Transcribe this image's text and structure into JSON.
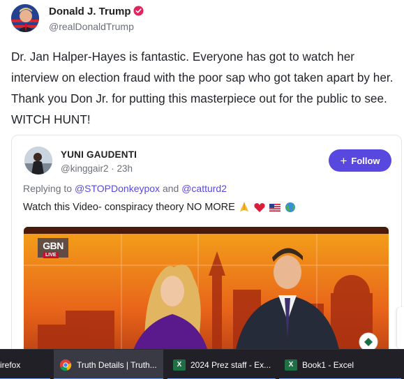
{
  "post": {
    "author_name": "Donald J. Trump",
    "author_handle": "@realDonaldTrump",
    "text": "Dr. Jan Halper-Hayes is fantastic. Everyone has got to watch her interview on election fraud with the poor sap who got taken apart by her. Thank you Don Jr. for putting this masterpiece out for the public to see. WITCH HUNT!"
  },
  "quote": {
    "author_name": "YUNI GAUDENTI",
    "author_handle": "@kinggair2",
    "time": "23h",
    "follow_label": "Follow",
    "replying_prefix": "Replying to",
    "replying_to_1": "@STOPDonkeypox",
    "replying_and": "and",
    "replying_to_2": "@catturd2",
    "text": "Watch this Video- conspiracy theory NO MORE",
    "video": {
      "logo": "GBN",
      "live_label": "LIVE"
    }
  },
  "taskbar": {
    "items": [
      {
        "label": "irefox",
        "icon": "firefox-icon"
      },
      {
        "label": "Truth Details | Truth...",
        "icon": "chrome-icon"
      },
      {
        "label": "2024 Prez staff - Ex...",
        "icon": "excel-icon"
      },
      {
        "label": "Book1 - Excel",
        "icon": "excel-icon"
      }
    ]
  },
  "colors": {
    "accent": "#5848e0",
    "verified": "#e0245e",
    "taskbar": "#202026",
    "excel": "#1d7044"
  }
}
